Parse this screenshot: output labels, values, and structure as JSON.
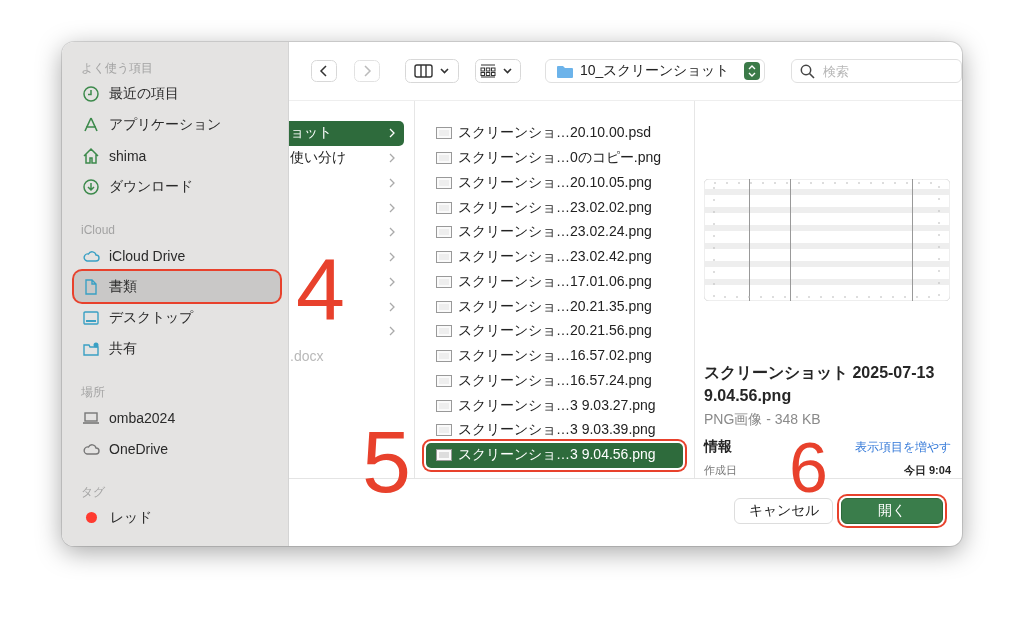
{
  "sidebar": {
    "sections": [
      {
        "title": "よく使う項目",
        "items": [
          {
            "label": "最近の項目",
            "selected": false,
            "annotated": false
          },
          {
            "label": "アプリケーション",
            "selected": false,
            "annotated": false
          },
          {
            "label": "shima",
            "selected": false,
            "annotated": false
          },
          {
            "label": "ダウンロード",
            "selected": false,
            "annotated": false
          }
        ]
      },
      {
        "title": "iCloud",
        "items": [
          {
            "label": "iCloud Drive",
            "selected": false,
            "annotated": false
          },
          {
            "label": "書類",
            "selected": true,
            "annotated": true
          },
          {
            "label": "デスクトップ",
            "selected": false,
            "annotated": false
          },
          {
            "label": "共有",
            "selected": false,
            "annotated": false
          }
        ]
      },
      {
        "title": "場所",
        "items": [
          {
            "label": "omba2024",
            "selected": false,
            "annotated": false
          },
          {
            "label": "OneDrive",
            "selected": false,
            "annotated": false
          }
        ]
      },
      {
        "title": "タグ",
        "items": [
          {
            "label": "レッド",
            "selected": false,
            "annotated": false,
            "color": "#ff3b30"
          }
        ]
      }
    ]
  },
  "toolbar": {
    "path": "10_スクリーンショット",
    "search": {
      "placeholder": "検索"
    }
  },
  "columns": [
    {
      "items": [
        {
          "label": "ョット",
          "selected": true,
          "disabled": false,
          "folder": true
        },
        {
          "label": "使い分け",
          "selected": false,
          "disabled": false,
          "folder": true
        },
        {
          "selected": false,
          "disabled": false,
          "folder": true
        },
        {
          "selected": false,
          "disabled": false,
          "folder": true
        },
        {
          "selected": false,
          "disabled": false,
          "folder": true
        },
        {
          "selected": false,
          "disabled": false,
          "folder": true
        },
        {
          "selected": false,
          "disabled": false,
          "folder": true
        },
        {
          "selected": false,
          "disabled": false,
          "folder": true
        },
        {
          "selected": false,
          "disabled": false,
          "folder": true
        },
        {
          "label": ".docx",
          "selected": false,
          "disabled": true,
          "folder": false
        }
      ]
    },
    {
      "items": [
        {
          "label": "スクリーンショ…20.10.00.psd",
          "selected": false,
          "annotated": false
        },
        {
          "label": "スクリーンショ…0のコピー.png",
          "selected": false,
          "annotated": false
        },
        {
          "label": "スクリーンショ…20.10.05.png",
          "selected": false,
          "annotated": false
        },
        {
          "label": "スクリーンショ…23.02.02.png",
          "selected": false,
          "annotated": false
        },
        {
          "label": "スクリーンショ…23.02.24.png",
          "selected": false,
          "annotated": false
        },
        {
          "label": "スクリーンショ…23.02.42.png",
          "selected": false,
          "annotated": false
        },
        {
          "label": "スクリーンショ…17.01.06.png",
          "selected": false,
          "annotated": false
        },
        {
          "label": "スクリーンショ…20.21.35.png",
          "selected": false,
          "annotated": false
        },
        {
          "label": "スクリーンショ…20.21.56.png",
          "selected": false,
          "annotated": false
        },
        {
          "label": "スクリーンショ…16.57.02.png",
          "selected": false,
          "annotated": false
        },
        {
          "label": "スクリーンショ…16.57.24.png",
          "selected": false,
          "annotated": false
        },
        {
          "label": "スクリーンショ…3 9.03.27.png",
          "selected": false,
          "annotated": false
        },
        {
          "label": "スクリーンショ…3 9.03.39.png",
          "selected": false,
          "annotated": false
        },
        {
          "label": "スクリーンショ…3 9.04.56.png",
          "selected": true,
          "annotated": true
        }
      ]
    }
  ],
  "preview": {
    "name": "スクリーンショット 2025-07-13 9.04.56.png",
    "kind": "PNG画像 - 348 KB",
    "info_title": "情報",
    "more_link": "表示項目を増やす",
    "rows": [
      {
        "label": "作成日",
        "value": "今日 9:04"
      }
    ]
  },
  "buttons": [
    {
      "label": "キャンセル",
      "kind": "secondary",
      "annotated": false
    },
    {
      "label": "開く",
      "kind": "primary",
      "annotated": true
    }
  ],
  "annotations": [
    {
      "text": "4"
    },
    {
      "text": "5"
    },
    {
      "text": "6"
    }
  ]
}
